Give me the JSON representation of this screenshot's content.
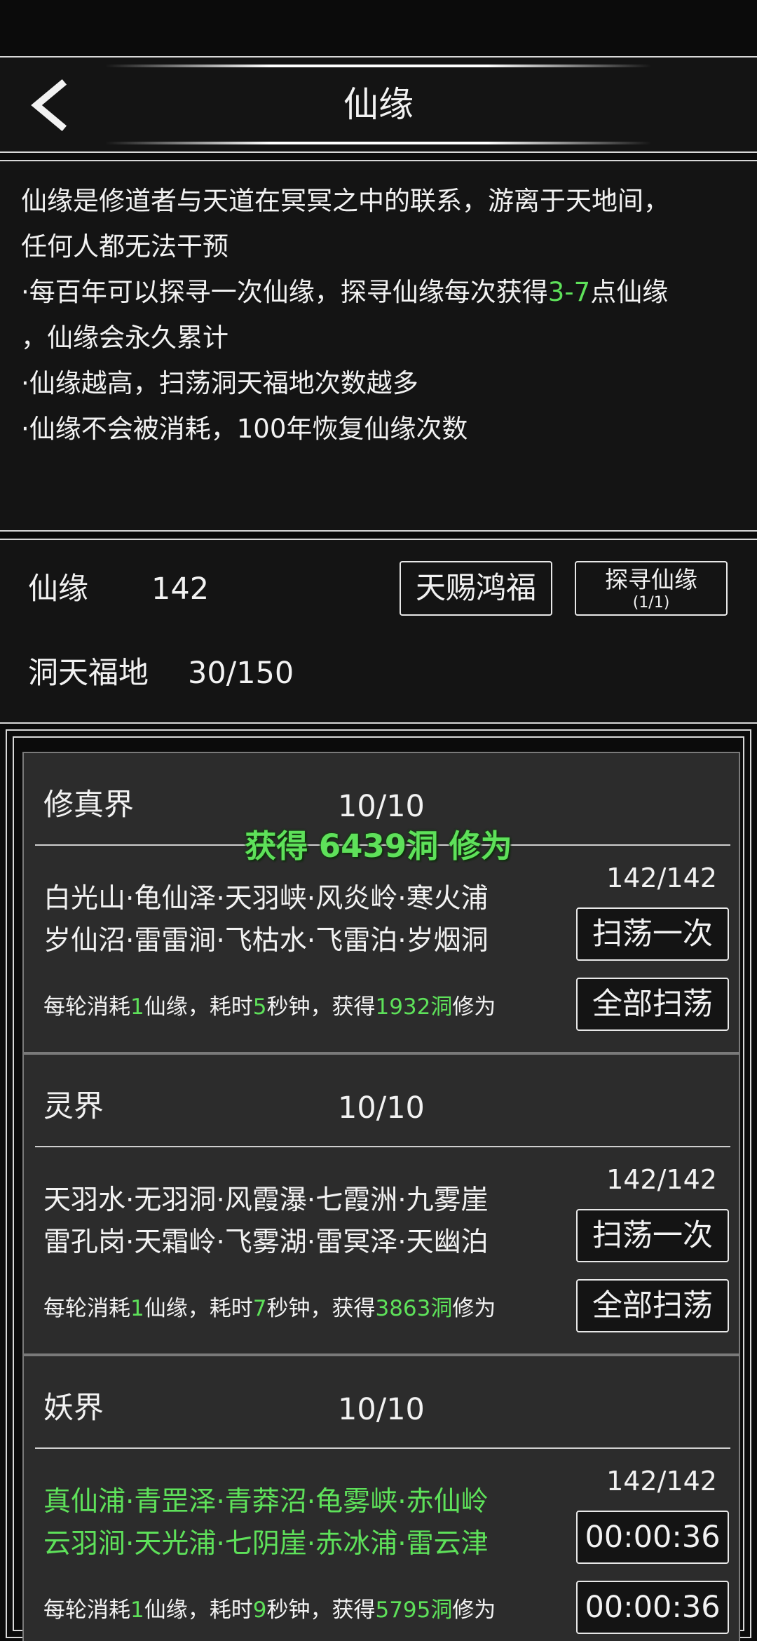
{
  "header": {
    "title": "仙缘"
  },
  "description": {
    "line1": "仙缘是修道者与天道在冥冥之中的联系，游离于天地间，",
    "line2": "任何人都无法干预",
    "line3_pre": "·每百年可以探寻一次仙缘，探寻仙缘每次获得",
    "line3_hl": "3-7",
    "line3_post": "点仙缘",
    "line4": "，仙缘会永久累计",
    "line5": "·仙缘越高，扫荡洞天福地次数越多",
    "line6": "·仙缘不会被消耗，100年恢复仙缘次数"
  },
  "status": {
    "xianyuan_label": "仙缘",
    "xianyuan_value": "142",
    "dongtian_label": "洞天福地",
    "dongtian_value": "30/150",
    "tianci_button": "天赐鸿福",
    "tanxun_button": "探寻仙缘",
    "tanxun_count": "(1/1)"
  },
  "reward_popup": "获得 6439洞 修为",
  "realms": [
    {
      "name": "修真界",
      "progress": "10/10",
      "places_line1": "白光山·龟仙泽·天羽峡·风炎岭·寒火浦",
      "places_line2": "岁仙沼·雷雷涧·飞枯水·飞雷泊·岁烟洞",
      "count": "142/142",
      "button1": "扫荡一次",
      "button2": "全部扫荡",
      "info_a": "每轮消耗",
      "info_cost": "1",
      "info_b": "仙缘，耗时",
      "info_time": "5",
      "info_c": "秒钟，获得",
      "info_gain": "1932洞",
      "info_d": "修为"
    },
    {
      "name": "灵界",
      "progress": "10/10",
      "places_line1": "天羽水·无羽洞·风霞瀑·七霞洲·九雾崖",
      "places_line2": "雷孔岗·天霜岭·飞雾湖·雷冥泽·天幽泊",
      "count": "142/142",
      "button1": "扫荡一次",
      "button2": "全部扫荡",
      "info_a": "每轮消耗",
      "info_cost": "1",
      "info_b": "仙缘，耗时",
      "info_time": "7",
      "info_c": "秒钟，获得",
      "info_gain": "3863洞",
      "info_d": "修为"
    },
    {
      "name": "妖界",
      "progress": "10/10",
      "places_line1": "真仙浦·青罡泽·青莽沼·龟雾峡·赤仙岭",
      "places_line2": "云羽涧·天光浦·七阴崖·赤冰浦·雷云津",
      "count": "142/142",
      "button1": "00:00:36",
      "button2": "00:00:36",
      "info_a": "每轮消耗",
      "info_cost": "1",
      "info_b": "仙缘，耗时",
      "info_time": "9",
      "info_c": "秒钟，获得",
      "info_gain": "5795洞",
      "info_d": "修为"
    }
  ],
  "colors": {
    "highlight": "#5ee15a",
    "panel": "#2c2c2c",
    "background": "#141414"
  }
}
